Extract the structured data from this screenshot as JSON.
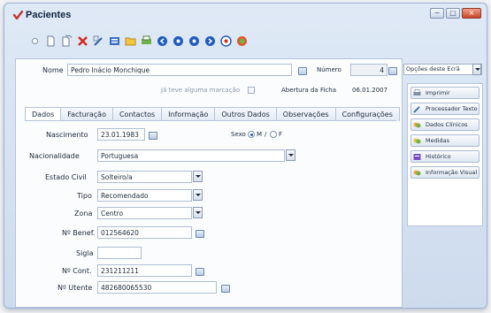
{
  "window": {
    "title": "Pacientes",
    "min_label": "−",
    "max_label": "□",
    "close_label": "×"
  },
  "toolbar": {
    "icons": [
      "new-icon",
      "new-doc-icon",
      "copy-doc-icon",
      "delete-icon",
      "edit-icon",
      "list-icon",
      "folder-icon",
      "print-icon",
      "nav-first-icon",
      "nav-prev-icon",
      "nav-next-icon",
      "nav-last-icon",
      "refresh-icon",
      "exit-icon"
    ]
  },
  "header": {
    "nome_label": "Nome",
    "nome_value": "Pedro Inácio Monchique",
    "numero_label": "Número",
    "numero_value": "4",
    "marcacao_label": "Já teve alguma marcação",
    "abertura_label": "Abertura da Ficha",
    "abertura_value": "06.01.2007"
  },
  "tabs": [
    {
      "label": "Dados",
      "active": true
    },
    {
      "label": "Facturação",
      "active": false
    },
    {
      "label": "Contactos",
      "active": false
    },
    {
      "label": "Informação",
      "active": false
    },
    {
      "label": "Outros Dados",
      "active": false
    },
    {
      "label": "Observações",
      "active": false
    },
    {
      "label": "Configurações",
      "active": false
    }
  ],
  "dados": {
    "nascimento_label": "Nascimento",
    "nascimento_value": "23.01.1983",
    "sexo_label": "Sexo",
    "sexo_m": "M",
    "sexo_sep": "/",
    "sexo_f": "F",
    "nacionalidade_label": "Nacionalidade",
    "nacionalidade_value": "Portuguesa",
    "estado_civil_label": "Estado Civil",
    "estado_civil_value": "Solteiro/a",
    "tipo_label": "Tipo",
    "tipo_value": "Recomendado",
    "zona_label": "Zona",
    "zona_value": "Centro",
    "benef_label": "Nº Benef.",
    "benef_value": "012564620",
    "sigla_label": "Sigla",
    "sigla_value": "",
    "cont_label": "Nº Cont.",
    "cont_value": "231211211",
    "utente_label": "Nº Utente",
    "utente_value": "482680065530"
  },
  "side": {
    "options_label": "Opções deste Ecrã",
    "buttons": [
      {
        "label": "Imprimir",
        "icon": "printer-icon"
      },
      {
        "label": "Processador Texto",
        "icon": "pen-icon"
      },
      {
        "label": "Dados Clínicos",
        "icon": "clinical-data-icon"
      },
      {
        "label": "Medidas",
        "icon": "measures-icon"
      },
      {
        "label": "Histórico",
        "icon": "history-icon"
      },
      {
        "label": "Informação Visual",
        "icon": "visual-info-icon"
      }
    ]
  },
  "colors": {
    "window_bg": "#cddbee",
    "accent_blue": "#2f5fa8",
    "delete_red": "#d42a1e",
    "nav_blue": "#1f5bc0"
  }
}
